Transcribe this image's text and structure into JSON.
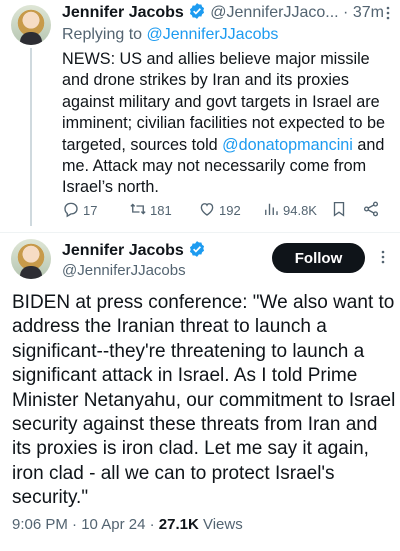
{
  "reply_tweet": {
    "author_name": "Jennifer Jacobs",
    "author_handle": "@JenniferJJaco...",
    "separator": "·",
    "time_ago": "37m",
    "replying_prefix": "Replying to",
    "replying_handle": "@JenniferJJacobs",
    "text_1": "NEWS: US and allies believe major missile and drone strikes by Iran and its proxies against military and govt targets in Israel are imminent; civilian facilities not expected to be targeted, sources told ",
    "mention": "@donatopmancini",
    "text_2": " and me. Attack may not necessarily come from Israel’s north.",
    "stats": {
      "replies": "17",
      "reposts": "181",
      "likes": "192",
      "views": "94.8K"
    }
  },
  "main_tweet": {
    "author_name": "Jennifer Jacobs",
    "author_handle": "@JenniferJJacobs",
    "follow_label": "Follow",
    "text": "BIDEN at press conference: \"We also want to address the Iranian threat to launch a significant--they're threatening to launch a significant attack in Israel. As I told Prime Minister Netanyahu, our commitment to Israel security against these threats from Iran and its proxies is iron clad. Let me say it again, iron clad - all we can to protect Israel's security.\"",
    "time": "9:06 PM",
    "date": "10 Apr 24",
    "dot": "·",
    "views_count": "27.1K",
    "views_label": "Views"
  },
  "icons": [
    "verified-badge-icon",
    "more-icon",
    "reply-icon",
    "repost-icon",
    "like-icon",
    "views-icon",
    "bookmark-icon",
    "share-icon"
  ],
  "colors": {
    "accent": "#1d9bf0",
    "text": "#0f1419",
    "muted": "#536471",
    "follow_bg": "#0f1419"
  }
}
